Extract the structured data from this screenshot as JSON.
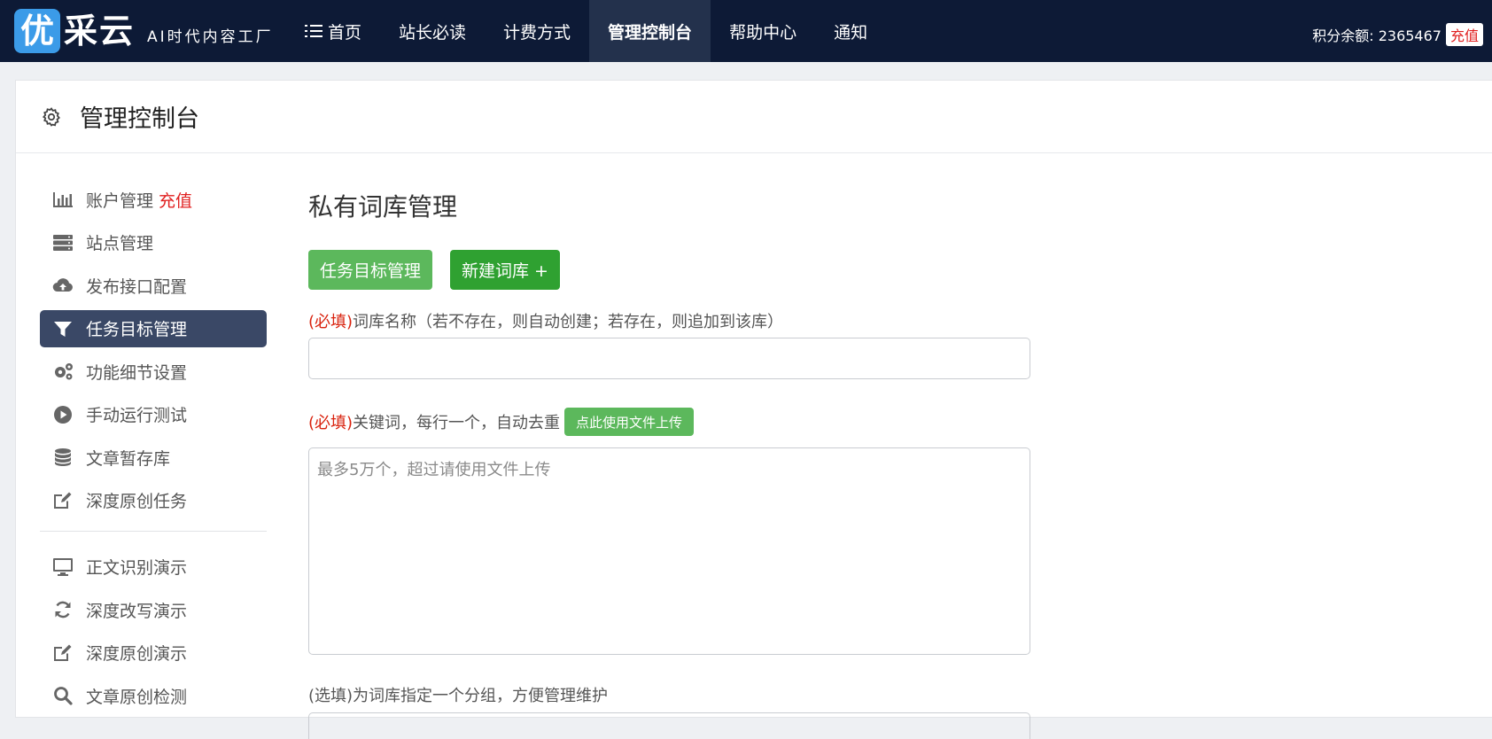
{
  "header": {
    "logo_badge": "优",
    "logo_name": "采云",
    "logo_slogan": "AI时代内容工厂",
    "nav": [
      {
        "label": "首页",
        "icon": "list-icon"
      },
      {
        "label": "站长必读"
      },
      {
        "label": "计费方式"
      },
      {
        "label": "管理控制台",
        "active": true
      },
      {
        "label": "帮助中心"
      },
      {
        "label": "通知"
      }
    ],
    "credits_label": "积分余额: 2365467",
    "recharge_label": "充值"
  },
  "panel": {
    "title": "管理控制台"
  },
  "sidebar": {
    "items": [
      {
        "label": "账户管理",
        "extra": "充值",
        "icon": "bar-chart-icon"
      },
      {
        "label": "站点管理",
        "icon": "server-icon"
      },
      {
        "label": "发布接口配置",
        "icon": "cloud-upload-icon"
      },
      {
        "label": "任务目标管理",
        "icon": "filter-icon",
        "active": true
      },
      {
        "label": "功能细节设置",
        "icon": "gears-icon"
      },
      {
        "label": "手动运行测试",
        "icon": "play-circle-icon"
      },
      {
        "label": "文章暂存库",
        "icon": "database-icon"
      },
      {
        "label": "深度原创任务",
        "icon": "edit-icon"
      }
    ],
    "items2": [
      {
        "label": "正文识别演示",
        "icon": "monitor-icon"
      },
      {
        "label": "深度改写演示",
        "icon": "refresh-icon"
      },
      {
        "label": "深度原创演示",
        "icon": "edit-icon"
      },
      {
        "label": "文章原创检测",
        "icon": "search-icon"
      }
    ]
  },
  "main": {
    "title": "私有词库管理",
    "btn_task_target": "任务目标管理",
    "btn_new_lib": "新建词库 +",
    "required_tag": "(必填)",
    "name_label": "词库名称（若不存在，则自动创建；若存在，则追加到该库）",
    "keyword_label": "关键词，每行一个，自动去重",
    "upload_btn": "点此使用文件上传",
    "keyword_placeholder": "最多5万个，超过请使用文件上传",
    "group_label": "(选填)为词库指定一个分组，方便管理维护"
  },
  "colors": {
    "topbar": "#0d1a36",
    "active_sidebar": "#3a4866",
    "green": "#5cb85c",
    "green_dark": "#2fa131",
    "required_red": "#d9230f"
  }
}
